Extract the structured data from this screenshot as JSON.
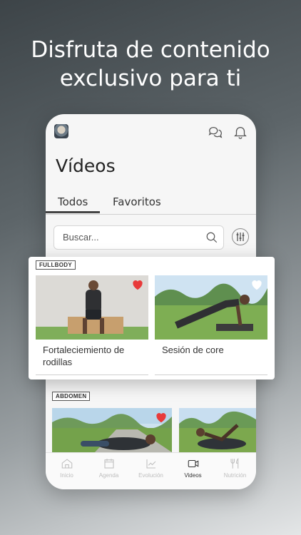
{
  "headline": {
    "line1": "Disfruta de contenido",
    "line2": "exclusivo para ti"
  },
  "page": {
    "title": "Vídeos"
  },
  "tabs": [
    {
      "label": "Todos",
      "active": true
    },
    {
      "label": "Favoritos",
      "active": false
    }
  ],
  "search": {
    "placeholder": "Buscar..."
  },
  "sections": [
    {
      "tag": "FULLBODY",
      "videos": [
        {
          "title": "Fortaleciemiento de rodillas",
          "favorite": true
        },
        {
          "title": "Sesión de core",
          "favorite": false
        }
      ]
    },
    {
      "tag": "ABDOMEN",
      "videos": [
        {
          "title": "",
          "favorite": true
        },
        {
          "title": "",
          "favorite": false
        }
      ]
    }
  ],
  "bottom_nav": [
    {
      "label": "Inicio",
      "icon": "home-icon",
      "active": false
    },
    {
      "label": "Agenda",
      "icon": "calendar-icon",
      "active": false
    },
    {
      "label": "Evolución",
      "icon": "chart-icon",
      "active": false
    },
    {
      "label": "Videos",
      "icon": "video-icon",
      "active": true
    },
    {
      "label": "Nutrición",
      "icon": "cutlery-icon",
      "active": false
    }
  ],
  "colors": {
    "heart": "#e83a3a",
    "accent": "#444444"
  }
}
